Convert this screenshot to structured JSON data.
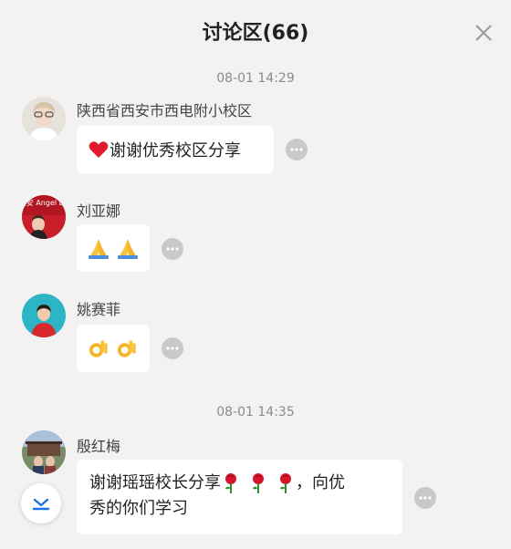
{
  "header": {
    "title": "讨论区(66)",
    "close_icon": "close-icon"
  },
  "messages": [
    {
      "time": "08-01 14:29",
      "sender": "陕西省西安市西电附小校区",
      "text": "谢谢优秀校区分享",
      "emojis": [
        "heart"
      ]
    },
    {
      "sender": "刘亚娜",
      "text": "",
      "emojis": [
        "folded-hands",
        "folded-hands"
      ]
    },
    {
      "sender": "姚赛菲",
      "text": "",
      "emojis": [
        "ok-hand",
        "ok-hand"
      ]
    },
    {
      "time": "08-01 14:35",
      "sender": "殷红梅",
      "text_line1_prefix": "谢谢瑶瑶校长分享",
      "text_line1_suffix": "，向优",
      "text_line2": "秀的你们学习",
      "emojis": [
        "rose",
        "rose",
        "rose"
      ]
    }
  ],
  "avatar_labels": {
    "liu": "贝贝安 Angel Bear"
  },
  "scroll_button": {
    "icon": "scroll-to-bottom-icon"
  },
  "colors": {
    "background": "#f2f2f2",
    "bubble": "#ffffff",
    "time": "#8a8a8a",
    "more_button": "#c9c9c9",
    "scroll_arrow": "#1a73e8"
  }
}
